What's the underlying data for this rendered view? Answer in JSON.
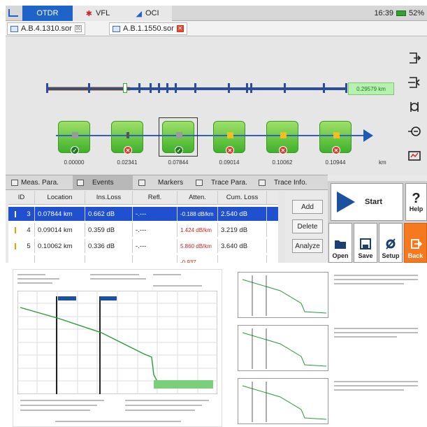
{
  "topbar": {
    "tabs": [
      "OTDR",
      "VFL",
      "OCI"
    ],
    "time": "16:39",
    "battery": "52%"
  },
  "files": [
    {
      "name": "A.B.4.1310.sor",
      "close": "☒"
    },
    {
      "name": "A.B.1.1550.sor",
      "close": "✕"
    }
  ],
  "map": {
    "distance_box": "0.29579 km",
    "unit": "km",
    "event_distances": [
      "0.00000",
      "0.02341",
      "0.07844",
      "0.09014",
      "0.10062",
      "0.10944"
    ]
  },
  "event_tabs": [
    "Meas. Para.",
    "Events",
    "Markers",
    "Trace Para.",
    "Trace Info."
  ],
  "table": {
    "headers": [
      "ID",
      "Location",
      "Ins.Loss",
      "Refl.",
      "Atten.",
      "Cum. Loss"
    ],
    "rows": [
      {
        "id": "3",
        "location": "0.07844 km",
        "ins_loss": "0.662 dB",
        "refl": "-.---",
        "atten": "-0.188 dB/km",
        "cum": "2.540 dB"
      },
      {
        "id": "4",
        "location": "0.09014 km",
        "ins_loss": "0.359 dB",
        "refl": "-.---",
        "atten": "1.424 dB/km",
        "cum": "3.219 dB"
      },
      {
        "id": "5",
        "location": "0.10062 km",
        "ins_loss": "0.336 dB",
        "refl": "-.---",
        "atten": "5.860 dB/km",
        "cum": "3.640 dB"
      },
      {
        "id": "",
        "location": "",
        "ins_loss": "",
        "refl": "",
        "atten": "-0.937",
        "cum": ""
      }
    ]
  },
  "side_buttons": {
    "add": "Add",
    "delete": "Delete",
    "analyze": "Analyze"
  },
  "panel": {
    "start": "Start",
    "help": "Help",
    "help_glyph": "?",
    "open": "Open",
    "save": "Save",
    "setup": "Setup",
    "back": "Back"
  },
  "colors": {
    "accent": "#1e64c8",
    "selection": "#1e50d0",
    "back_button": "#f5791f",
    "event_green": "#3fb12a"
  }
}
